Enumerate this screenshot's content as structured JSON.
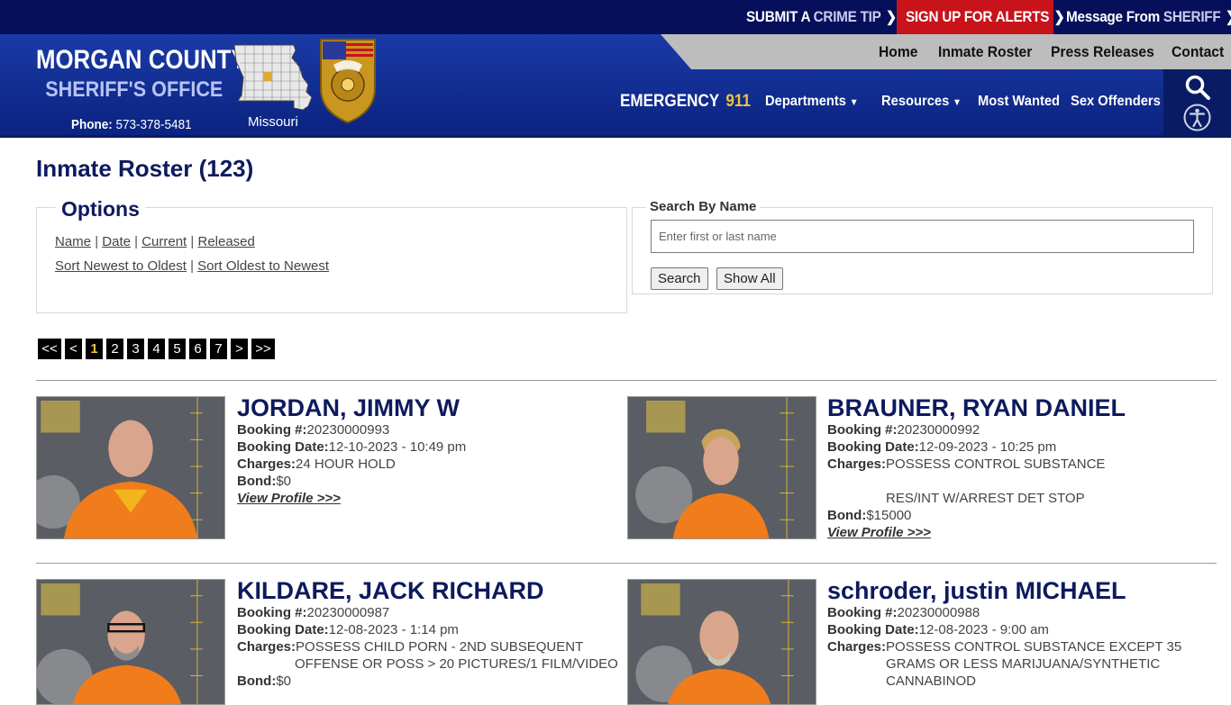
{
  "topbar": {
    "submit_tip": {
      "a": "SUBMIT A ",
      "b": "CRIME TIP"
    },
    "alerts": "SIGN UP FOR ALERTS",
    "message": {
      "a": "Message From ",
      "b": "SHERIFF"
    }
  },
  "header": {
    "title": "MORGAN COUNTY",
    "subtitle": "SHERIFF'S OFFICE",
    "phone_label": "Phone:",
    "phone_number": "573-378-5481",
    "state": "Missouri",
    "emergency_label": "EMERGENCY",
    "emergency_number": "911"
  },
  "top_nav": [
    "Home",
    "Inmate Roster",
    "Press Releases",
    "Contact"
  ],
  "main_nav": {
    "departments": "Departments",
    "resources": "Resources",
    "most_wanted": "Most Wanted",
    "sex_offenders": "Sex Offenders"
  },
  "icons": {
    "search": "search-icon",
    "accessibility": "accessibility-icon"
  },
  "colors": {
    "navy": "#050f5a",
    "alert_red": "#c8131b",
    "accent_gold": "#f0c23a",
    "heading": "#0d1a5e"
  },
  "page": {
    "title": "Inmate Roster (123)"
  },
  "options": {
    "legend": "Options",
    "sort_links": [
      "Name",
      "Date",
      "Current",
      "Released"
    ],
    "order_links": [
      "Sort Newest to Oldest",
      "Sort Oldest to Newest"
    ],
    "sep": "|"
  },
  "search": {
    "legend": "Search By Name",
    "placeholder": "Enter first or last name",
    "search_button": "Search",
    "show_all_button": "Show All"
  },
  "pager": {
    "first": "<<",
    "prev": "<",
    "pages": [
      "1",
      "2",
      "3",
      "4",
      "5",
      "6",
      "7"
    ],
    "current": "1",
    "next": ">",
    "last": ">>"
  },
  "labels": {
    "booking_no": "Booking #:",
    "booking_date": "Booking Date:",
    "charges": "Charges:",
    "bond": "Bond:",
    "view_profile": "View Profile >>>"
  },
  "inmates": [
    {
      "name": "JORDAN, JIMMY W",
      "booking_no": "20230000993",
      "booking_date": "12-10-2023 - 10:49 pm",
      "charges": [
        "24 HOUR HOLD"
      ],
      "bond": "$0"
    },
    {
      "name": "BRAUNER, RYAN DANIEL",
      "booking_no": "20230000992",
      "booking_date": "12-09-2023 - 10:25 pm",
      "charges": [
        "POSSESS CONTROL SUBSTANCE",
        "",
        "RES/INT W/ARREST DET STOP"
      ],
      "bond": "$15000"
    },
    {
      "name": "KILDARE, JACK RICHARD",
      "booking_no": "20230000987",
      "booking_date": "12-08-2023 - 1:14 pm",
      "charges": [
        "POSSESS CHILD PORN - 2ND SUBSEQUENT",
        "OFFENSE OR POSS > 20 PICTURES/1 FILM/VIDEO"
      ],
      "bond": "$0"
    },
    {
      "name": "schroder, justin MICHAEL",
      "booking_no": "20230000988",
      "booking_date": "12-08-2023 - 9:00 am",
      "charges": [
        "POSSESS CONTROL SUBSTANCE EXCEPT 35",
        "GRAMS OR LESS MARIJUANA/SYNTHETIC",
        "CANNABINOD"
      ],
      "bond": ""
    }
  ]
}
